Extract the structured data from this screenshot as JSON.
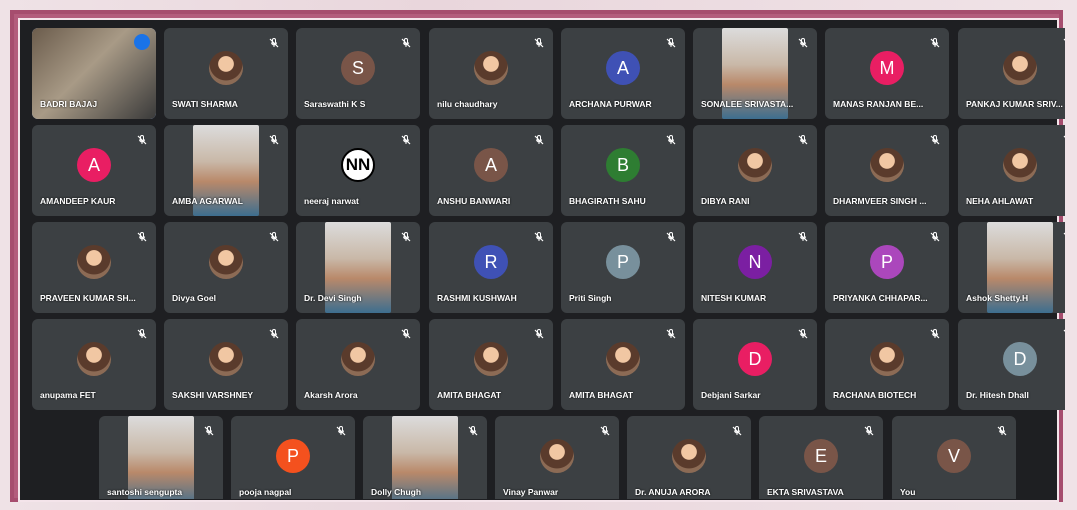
{
  "participants": [
    {
      "name": "BADRI BAJAJ",
      "avatar_type": "video",
      "speaking": true
    },
    {
      "name": "SWATI SHARMA",
      "avatar_type": "photo"
    },
    {
      "name": "Saraswathi K S",
      "avatar_type": "letter",
      "letter": "S",
      "color": "#795548"
    },
    {
      "name": "nilu chaudhary",
      "avatar_type": "photo"
    },
    {
      "name": "ARCHANA PURWAR",
      "avatar_type": "letter",
      "letter": "A",
      "color": "#3f51b5"
    },
    {
      "name": "SONALEE SRIVASTA...",
      "avatar_type": "video"
    },
    {
      "name": "MANAS RANJAN BE...",
      "avatar_type": "letter",
      "letter": "M",
      "color": "#e91e63"
    },
    {
      "name": "PANKAJ KUMAR SRIV...",
      "avatar_type": "photo"
    },
    {
      "name": "AMANDEEP KAUR",
      "avatar_type": "letter",
      "letter": "A",
      "color": "#e91e63"
    },
    {
      "name": "AMBA AGARWAL",
      "avatar_type": "video"
    },
    {
      "name": "neeraj narwat",
      "avatar_type": "nn",
      "letter": "NN"
    },
    {
      "name": "ANSHU BANWARI",
      "avatar_type": "letter",
      "letter": "A",
      "color": "#795548"
    },
    {
      "name": "BHAGIRATH SAHU",
      "avatar_type": "letter",
      "letter": "B",
      "color": "#2e7d32"
    },
    {
      "name": "DIBYA RANI",
      "avatar_type": "photo"
    },
    {
      "name": "DHARMVEER SINGH ...",
      "avatar_type": "photo"
    },
    {
      "name": "NEHA AHLAWAT",
      "avatar_type": "photo"
    },
    {
      "name": "PRAVEEN KUMAR SH...",
      "avatar_type": "photo"
    },
    {
      "name": "Divya Goel",
      "avatar_type": "photo"
    },
    {
      "name": "Dr. Devi Singh",
      "avatar_type": "video"
    },
    {
      "name": "RASHMI KUSHWAH",
      "avatar_type": "letter",
      "letter": "R",
      "color": "#3f51b5"
    },
    {
      "name": "Priti Singh",
      "avatar_type": "letter",
      "letter": "P",
      "color": "#78909c"
    },
    {
      "name": "NITESH KUMAR",
      "avatar_type": "letter",
      "letter": "N",
      "color": "#7b1fa2"
    },
    {
      "name": "PRIYANKA CHHAPAR...",
      "avatar_type": "letter",
      "letter": "P",
      "color": "#ab47bc"
    },
    {
      "name": "Ashok Shetty.H",
      "avatar_type": "video"
    },
    {
      "name": "anupama FET",
      "avatar_type": "photo"
    },
    {
      "name": "SAKSHI VARSHNEY",
      "avatar_type": "photo"
    },
    {
      "name": "Akarsh Arora",
      "avatar_type": "photo"
    },
    {
      "name": "AMITA BHAGAT",
      "avatar_type": "photo"
    },
    {
      "name": "AMITA BHAGAT",
      "avatar_type": "photo"
    },
    {
      "name": "Debjani Sarkar",
      "avatar_type": "letter",
      "letter": "D",
      "color": "#e91e63"
    },
    {
      "name": "RACHANA BIOTECH",
      "avatar_type": "photo"
    },
    {
      "name": "Dr. Hitesh Dhall",
      "avatar_type": "letter",
      "letter": "D",
      "color": "#78909c"
    },
    {
      "name": "santoshi sengupta",
      "avatar_type": "video"
    },
    {
      "name": "pooja nagpal",
      "avatar_type": "letter",
      "letter": "P",
      "color": "#f4511e"
    },
    {
      "name": "Dolly Chugh",
      "avatar_type": "video"
    },
    {
      "name": "Vinay Panwar",
      "avatar_type": "photo"
    },
    {
      "name": "Dr. ANUJA ARORA",
      "avatar_type": "photo"
    },
    {
      "name": "EKTA SRIVASTAVA",
      "avatar_type": "letter",
      "letter": "E",
      "color": "#795548"
    },
    {
      "name": "You",
      "avatar_type": "letter",
      "letter": "V",
      "color": "#795548"
    }
  ]
}
